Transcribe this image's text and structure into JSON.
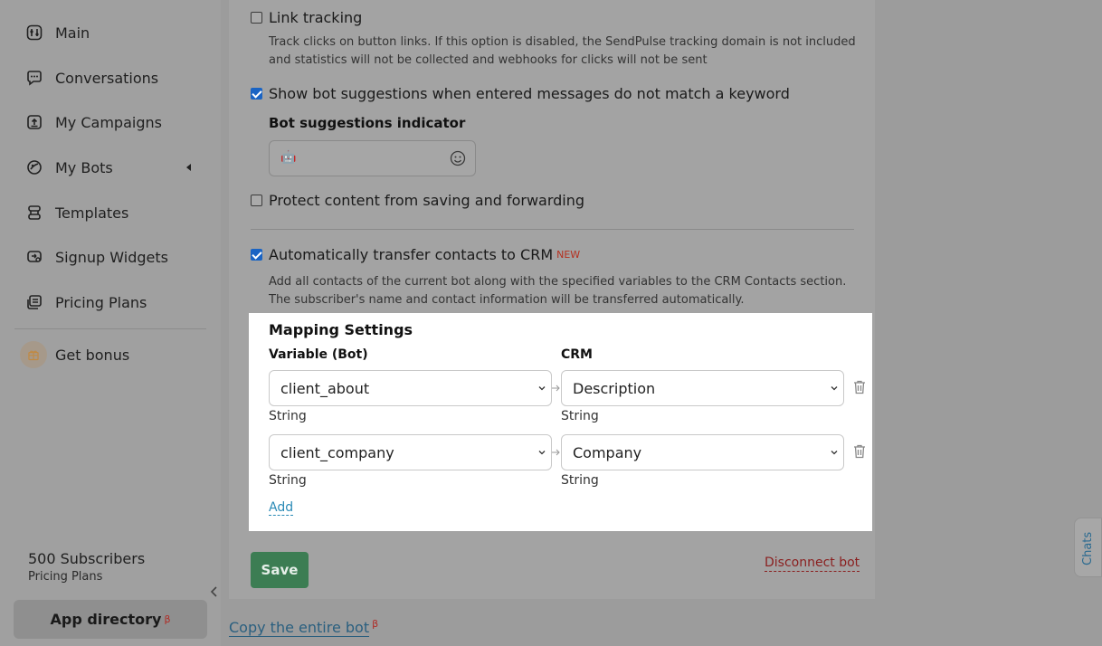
{
  "sidebar": {
    "items": [
      {
        "label": "Main",
        "icon": "dashboard-icon"
      },
      {
        "label": "Conversations",
        "icon": "chat-bubble-icon"
      },
      {
        "label": "My Campaigns",
        "icon": "campaign-upload-icon"
      },
      {
        "label": "My Bots",
        "icon": "bot-icon"
      },
      {
        "label": "Templates",
        "icon": "stack-icon"
      },
      {
        "label": "Signup Widgets",
        "icon": "widget-icon"
      },
      {
        "label": "Pricing Plans",
        "icon": "pricing-icon"
      }
    ],
    "bonus_label": "Get bonus",
    "subscribers": "500 Subscribers",
    "subscribers_sub": "Pricing Plans",
    "app_directory": "App directory",
    "beta_mark": "β"
  },
  "settings": {
    "link_tracking": {
      "label": "Link tracking",
      "checked": false,
      "desc1": "Track clicks on button links. If this option is disabled, the SendPulse tracking domain is not included",
      "desc2": "and statistics will not be collected and webhooks for clicks will not be sent"
    },
    "bot_suggestions": {
      "label": "Show bot suggestions when entered messages do not match a keyword",
      "checked": true
    },
    "indicator_label": "Bot suggestions indicator",
    "indicator_value": "🤖",
    "protect": {
      "label": "Protect content from saving and forwarding",
      "checked": false
    },
    "crm_transfer": {
      "label": "Automatically transfer contacts to CRM",
      "badge": "NEW",
      "checked": true,
      "desc1": "Add all contacts of the current bot along with the specified variables to the CRM Contacts section.",
      "desc2": "The subscriber's name and contact information will be transferred automatically."
    }
  },
  "mapping": {
    "title": "Mapping Settings",
    "col_bot": "Variable (Bot)",
    "col_crm": "CRM",
    "rows": [
      {
        "bot_var": "client_about",
        "bot_type": "String",
        "crm_field": "Description",
        "crm_type": "String"
      },
      {
        "bot_var": "client_company",
        "bot_type": "String",
        "crm_field": "Company",
        "crm_type": "String"
      }
    ],
    "add_label": "Add"
  },
  "actions": {
    "save": "Save",
    "disconnect": "Disconnect bot",
    "copy_bot": "Copy the entire bot",
    "copy_beta": "β"
  },
  "chats_tab": "Chats",
  "colors": {
    "accent": "#2a8ab6",
    "save": "#3c7d53",
    "danger": "#8a1f1f",
    "checkbox": "#1a64c4"
  }
}
